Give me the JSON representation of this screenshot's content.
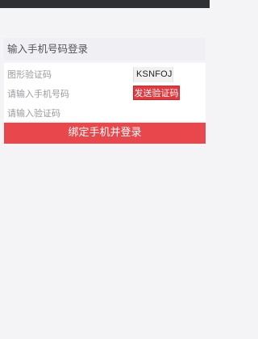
{
  "header": {
    "title": "输入手机号码登录"
  },
  "form": {
    "captcha_placeholder": "图形验证码",
    "captcha_image_text": "KSNFOJ",
    "phone_placeholder": "请输入手机号码",
    "send_code_label": "发送验证码",
    "code_placeholder": "请输入验证码"
  },
  "submit": {
    "label": "绑定手机并登录"
  },
  "colors": {
    "accent": "#e8474c",
    "status_bar": "#2f3033",
    "background": "#f4f4f6"
  }
}
